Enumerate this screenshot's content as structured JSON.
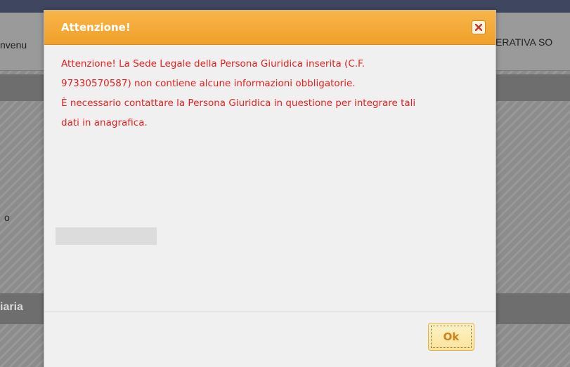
{
  "background": {
    "nav_left_text": "nvenu",
    "nav_right_text": "ERATIVA SO",
    "side_text": "o",
    "section_label": "iaria"
  },
  "dialog": {
    "title": "Attenzione!",
    "close_icon": "close-icon",
    "message_lines": [
      "Attenzione! La Sede Legale della Persona Giuridica inserita (C.F.",
      "97330570587) non contiene alcune informazioni obbligatorie.",
      "È necessario contattare la Persona Giuridica in questione per integrare tali",
      "dati in anagrafica."
    ],
    "ok_label": "Ok"
  },
  "colors": {
    "header_accent": "#f0a02b",
    "message_text": "#e8201f",
    "ok_text": "#d2811a"
  }
}
